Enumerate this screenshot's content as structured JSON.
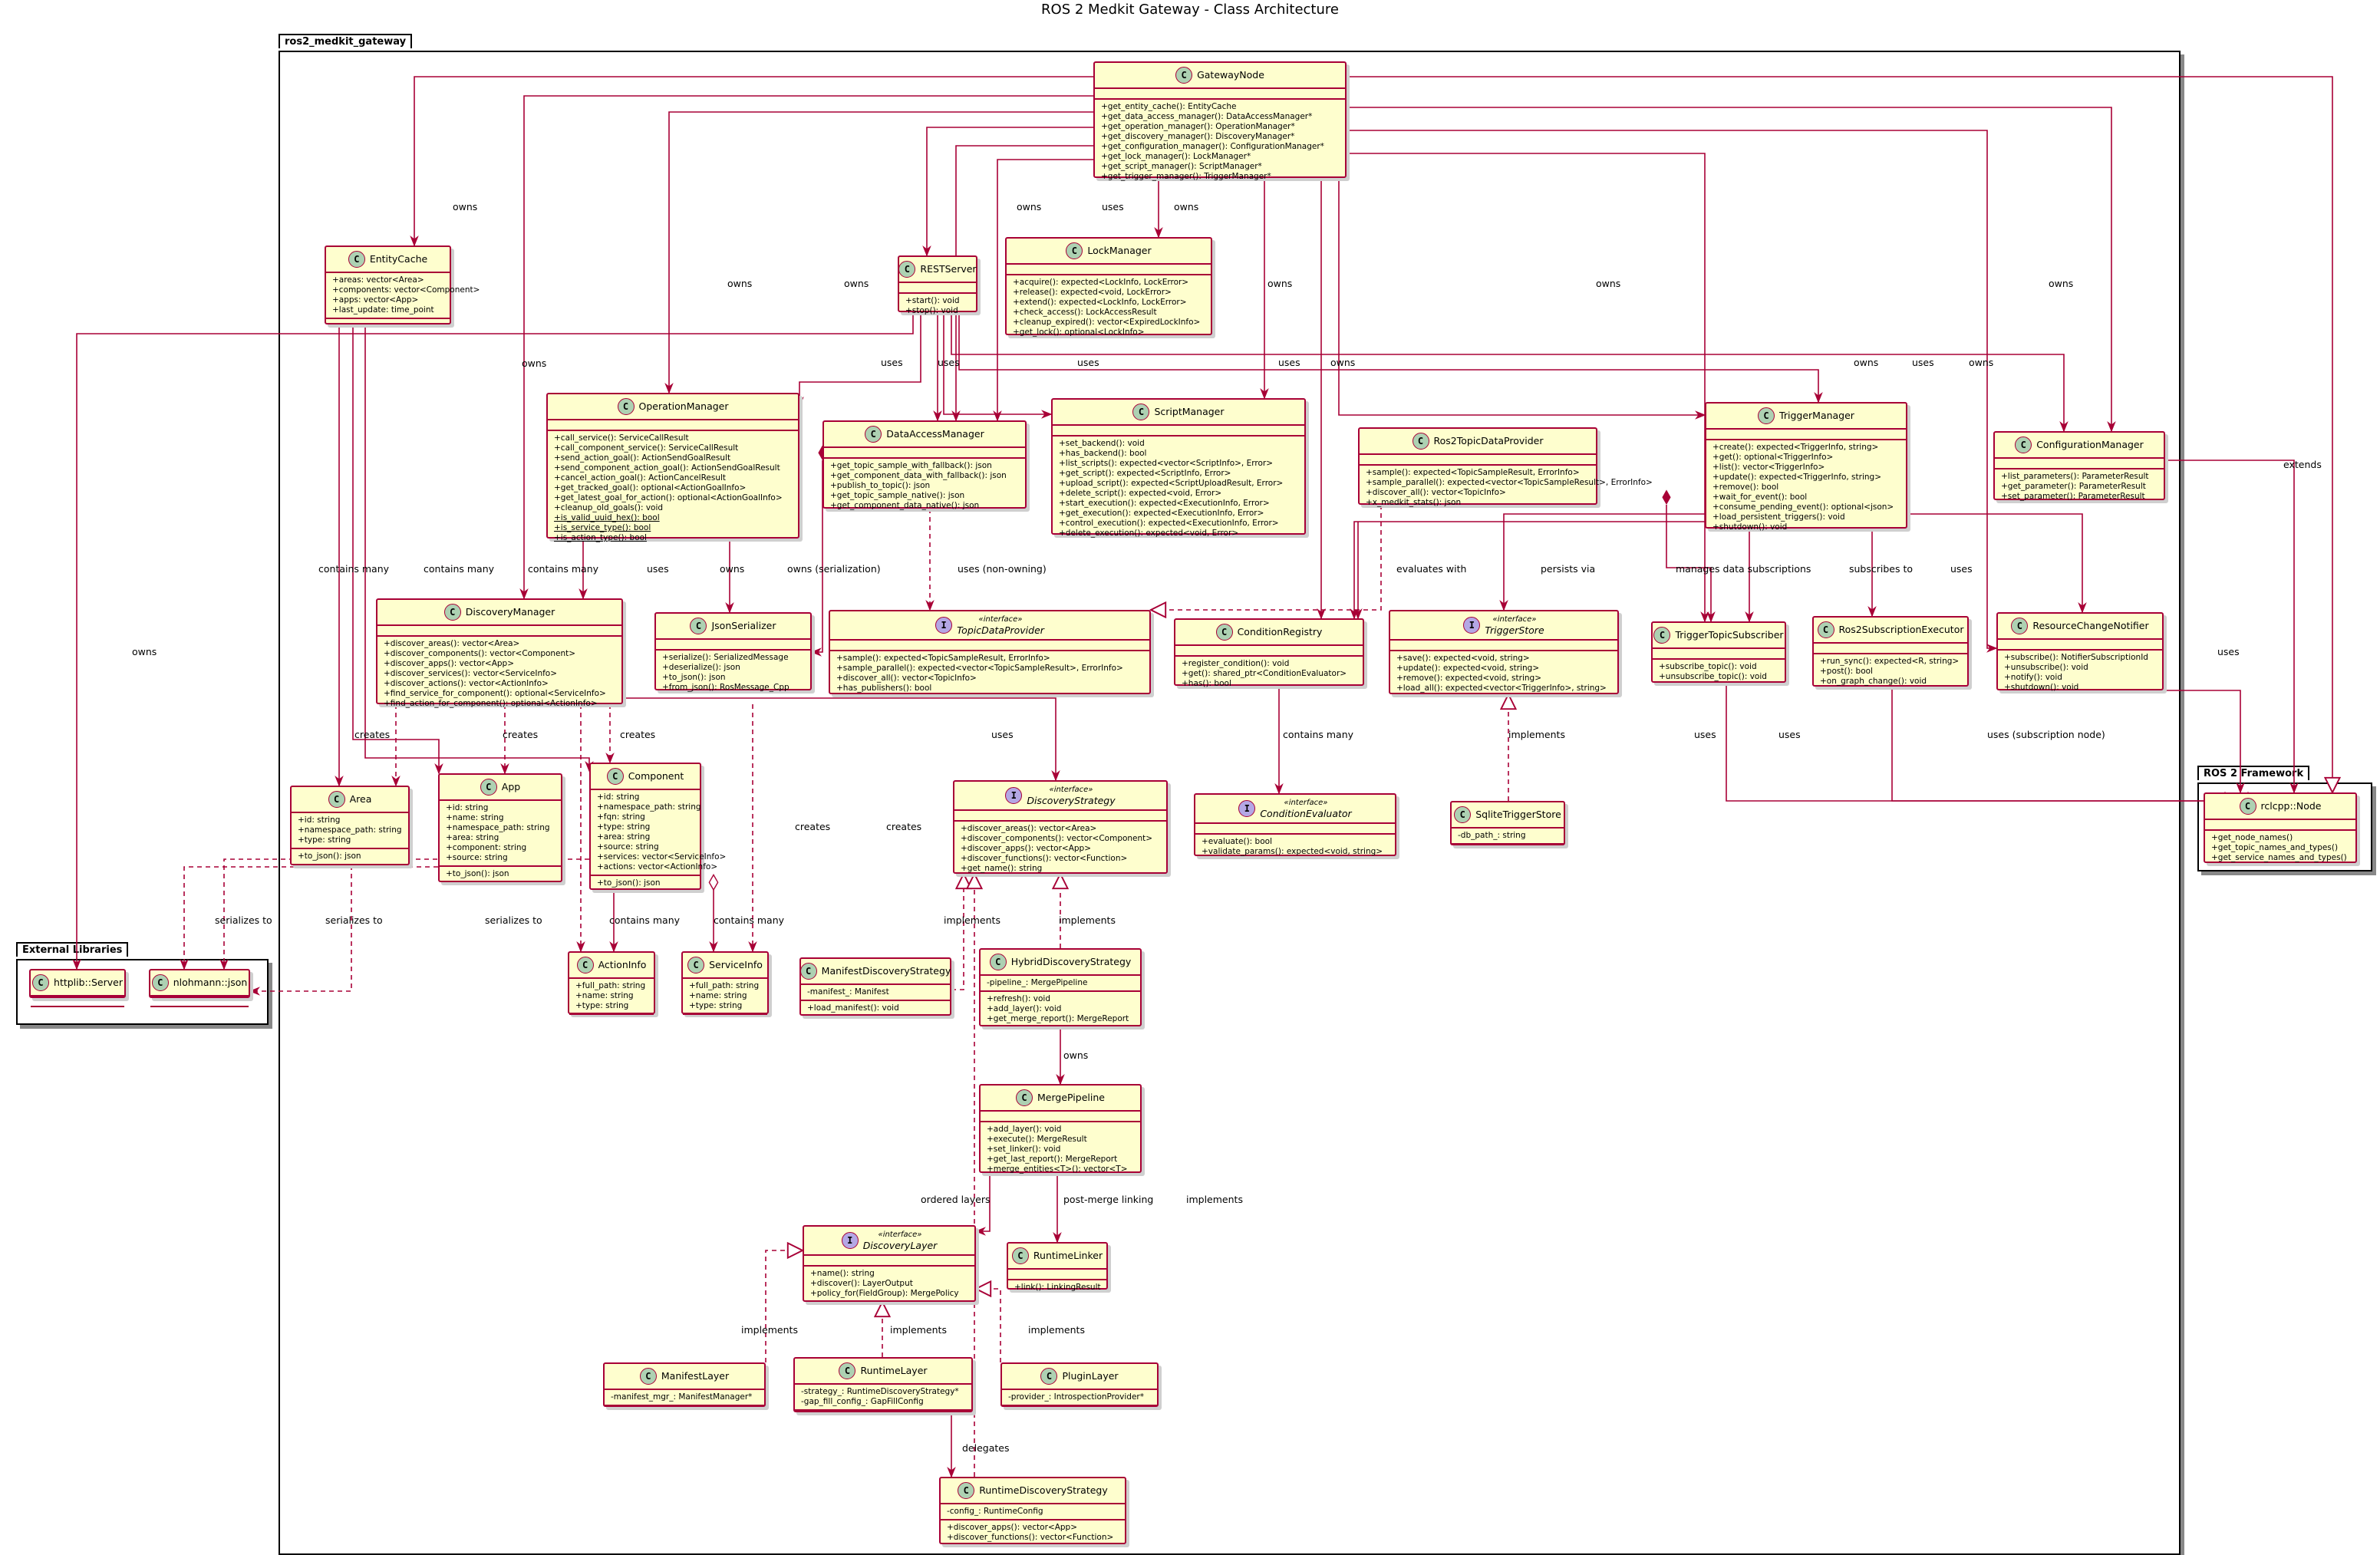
{
  "title": "ROS 2 Medkit Gateway - Class Architecture",
  "colors": {
    "border": "#A80036",
    "fill": "#FEFECE",
    "class_circle": "#ADD1B2",
    "interface_circle": "#B4A7E5"
  },
  "packages": {
    "gateway": {
      "name": "ros2_medkit_gateway"
    },
    "external": {
      "name": "External Libraries"
    },
    "ros2": {
      "name": "ROS 2 Framework"
    }
  },
  "classes": {
    "GatewayNode": {
      "name": "GatewayNode",
      "stereotype": "",
      "kind": "C",
      "attrs": [],
      "methods": [
        "+get_entity_cache(): EntityCache",
        "+get_data_access_manager(): DataAccessManager*",
        "+get_operation_manager(): OperationManager*",
        "+get_discovery_manager(): DiscoveryManager*",
        "+get_configuration_manager(): ConfigurationManager*",
        "+get_lock_manager(): LockManager*",
        "+get_script_manager(): ScriptManager*",
        "+get_trigger_manager(): TriggerManager*"
      ]
    },
    "EntityCache": {
      "name": "EntityCache",
      "kind": "C",
      "stereotype": "",
      "attrs": [
        "+areas: vector<Area>",
        "+components: vector<Component>",
        "+apps: vector<App>",
        "+last_update: time_point"
      ],
      "methods": []
    },
    "RESTServer": {
      "name": "RESTServer",
      "kind": "C",
      "stereotype": "",
      "attrs": [],
      "methods": [
        "+start(): void",
        "+stop(): void"
      ]
    },
    "LockManager": {
      "name": "LockManager",
      "kind": "C",
      "stereotype": "",
      "attrs": [],
      "methods": [
        "+acquire(): expected<LockInfo, LockError>",
        "+release(): expected<void, LockError>",
        "+extend(): expected<LockInfo, LockError>",
        "+check_access(): LockAccessResult",
        "+cleanup_expired(): vector<ExpiredLockInfo>",
        "+get_lock(): optional<LockInfo>"
      ]
    },
    "OperationManager": {
      "name": "OperationManager",
      "kind": "C",
      "stereotype": "",
      "attrs": [],
      "methods": [
        "+call_service(): ServiceCallResult",
        "+call_component_service(): ServiceCallResult",
        "+send_action_goal(): ActionSendGoalResult",
        "+send_component_action_goal(): ActionSendGoalResult",
        "+cancel_action_goal(): ActionCancelResult",
        "+get_tracked_goal(): optional<ActionGoalInfo>",
        "+get_latest_goal_for_action(): optional<ActionGoalInfo>",
        "+cleanup_old_goals(): void"
      ],
      "static_methods": [
        "+is_valid_uuid_hex(): bool",
        "+is_service_type(): bool",
        "+is_action_type(): bool"
      ]
    },
    "DataAccessManager": {
      "name": "DataAccessManager",
      "kind": "C",
      "stereotype": "",
      "attrs": [],
      "methods": [
        "+get_topic_sample_with_fallback(): json",
        "+get_component_data_with_fallback(): json",
        "+publish_to_topic(): json",
        "+get_topic_sample_native(): json",
        "+get_component_data_native(): json"
      ]
    },
    "ScriptManager": {
      "name": "ScriptManager",
      "kind": "C",
      "stereotype": "",
      "attrs": [],
      "methods": [
        "+set_backend(): void",
        "+has_backend(): bool",
        "+list_scripts(): expected<vector<ScriptInfo>, Error>",
        "+get_script(): expected<ScriptInfo, Error>",
        "+upload_script(): expected<ScriptUploadResult, Error>",
        "+delete_script(): expected<void, Error>",
        "+start_execution(): expected<ExecutionInfo, Error>",
        "+get_execution(): expected<ExecutionInfo, Error>",
        "+control_execution(): expected<ExecutionInfo, Error>",
        "+delete_execution(): expected<void, Error>"
      ]
    },
    "Ros2TopicDataProvider": {
      "name": "Ros2TopicDataProvider",
      "kind": "C",
      "stereotype": "",
      "attrs": [],
      "methods": [
        "+sample(): expected<TopicSampleResult, ErrorInfo>",
        "+sample_parallel(): expected<vector<TopicSampleResult>, ErrorInfo>",
        "+discover_all(): vector<TopicInfo>",
        "+x_medkit_stats(): json"
      ]
    },
    "TriggerManager": {
      "name": "TriggerManager",
      "kind": "C",
      "stereotype": "",
      "attrs": [],
      "methods": [
        "+create(): expected<TriggerInfo, string>",
        "+get(): optional<TriggerInfo>",
        "+list(): vector<TriggerInfo>",
        "+update(): expected<TriggerInfo, string>",
        "+remove(): bool",
        "+wait_for_event(): bool",
        "+consume_pending_event(): optional<json>",
        "+load_persistent_triggers(): void",
        "+shutdown(): void"
      ]
    },
    "ConfigurationManager": {
      "name": "ConfigurationManager",
      "kind": "C",
      "stereotype": "",
      "attrs": [],
      "methods": [
        "+list_parameters(): ParameterResult",
        "+get_parameter(): ParameterResult",
        "+set_parameter(): ParameterResult"
      ]
    },
    "DiscoveryManager": {
      "name": "DiscoveryManager",
      "kind": "C",
      "stereotype": "",
      "attrs": [],
      "methods": [
        "+discover_areas(): vector<Area>",
        "+discover_components(): vector<Component>",
        "+discover_apps(): vector<App>",
        "+discover_services(): vector<ServiceInfo>",
        "+discover_actions(): vector<ActionInfo>",
        "+find_service_for_component(): optional<ServiceInfo>",
        "+find_action_for_component(): optional<ActionInfo>"
      ]
    },
    "JsonSerializer": {
      "name": "JsonSerializer",
      "kind": "C",
      "stereotype": "",
      "attrs": [],
      "methods": [
        "+serialize(): SerializedMessage",
        "+deserialize(): json",
        "+to_json(): json",
        "+from_json(): RosMessage_Cpp"
      ]
    },
    "TopicDataProvider": {
      "name": "TopicDataProvider",
      "kind": "I",
      "stereotype": "«interface»",
      "attrs": [],
      "methods": [
        "+sample(): expected<TopicSampleResult, ErrorInfo>",
        "+sample_parallel(): expected<vector<TopicSampleResult>, ErrorInfo>",
        "+discover_all(): vector<TopicInfo>",
        "+has_publishers(): bool"
      ]
    },
    "ConditionRegistry": {
      "name": "ConditionRegistry",
      "kind": "C",
      "stereotype": "",
      "attrs": [],
      "methods": [
        "+register_condition(): void",
        "+get(): shared_ptr<ConditionEvaluator>",
        "+has(): bool"
      ]
    },
    "TriggerStore": {
      "name": "TriggerStore",
      "kind": "I",
      "stereotype": "«interface»",
      "attrs": [],
      "methods": [
        "+save(): expected<void, string>",
        "+update(): expected<void, string>",
        "+remove(): expected<void, string>",
        "+load_all(): expected<vector<TriggerInfo>, string>"
      ]
    },
    "TriggerTopicSubscriber": {
      "name": "TriggerTopicSubscriber",
      "kind": "C",
      "stereotype": "",
      "attrs": [],
      "methods": [
        "+subscribe_topic(): void",
        "+unsubscribe_topic(): void"
      ]
    },
    "Ros2SubscriptionExecutor": {
      "name": "Ros2SubscriptionExecutor",
      "kind": "C",
      "stereotype": "",
      "attrs": [],
      "methods": [
        "+run_sync(): expected<R, string>",
        "+post(): bool",
        "+on_graph_change(): void"
      ]
    },
    "ResourceChangeNotifier": {
      "name": "ResourceChangeNotifier",
      "kind": "C",
      "stereotype": "",
      "attrs": [],
      "methods": [
        "+subscribe(): NotifierSubscriptionId",
        "+unsubscribe(): void",
        "+notify(): void",
        "+shutdown(): void"
      ]
    },
    "Area": {
      "name": "Area",
      "kind": "C",
      "stereotype": "",
      "attrs": [
        "+id: string",
        "+namespace_path: string",
        "+type: string"
      ],
      "methods": [
        "+to_json(): json"
      ]
    },
    "App": {
      "name": "App",
      "kind": "C",
      "stereotype": "",
      "attrs": [
        "+id: string",
        "+name: string",
        "+namespace_path: string",
        "+area: string",
        "+component: string",
        "+source: string"
      ],
      "methods": [
        "+to_json(): json"
      ]
    },
    "Component": {
      "name": "Component",
      "kind": "C",
      "stereotype": "",
      "attrs": [
        "+id: string",
        "+namespace_path: string",
        "+fqn: string",
        "+type: string",
        "+area: string",
        "+source: string",
        "+services: vector<ServiceInfo>",
        "+actions: vector<ActionInfo>"
      ],
      "methods": [
        "+to_json(): json"
      ]
    },
    "DiscoveryStrategy": {
      "name": "DiscoveryStrategy",
      "kind": "I",
      "stereotype": "«interface»",
      "attrs": [],
      "methods": [
        "+discover_areas(): vector<Area>",
        "+discover_components(): vector<Component>",
        "+discover_apps(): vector<App>",
        "+discover_functions(): vector<Function>",
        "+get_name(): string"
      ]
    },
    "ConditionEvaluator": {
      "name": "ConditionEvaluator",
      "kind": "I",
      "stereotype": "«interface»",
      "attrs": [],
      "methods": [
        "+evaluate(): bool",
        "+validate_params(): expected<void, string>"
      ]
    },
    "SqliteTriggerStore": {
      "name": "SqliteTriggerStore",
      "kind": "C",
      "stereotype": "",
      "attrs": [
        "-db_path_: string"
      ],
      "methods": []
    },
    "ActionInfo": {
      "name": "ActionInfo",
      "kind": "C",
      "stereotype": "",
      "attrs": [
        "+full_path: string",
        "+name: string",
        "+type: string"
      ],
      "methods": []
    },
    "ServiceInfo": {
      "name": "ServiceInfo",
      "kind": "C",
      "stereotype": "",
      "attrs": [
        "+full_path: string",
        "+name: string",
        "+type: string"
      ],
      "methods": []
    },
    "ManifestDiscoveryStrategy": {
      "name": "ManifestDiscoveryStrategy",
      "kind": "C",
      "stereotype": "",
      "attrs": [
        "-manifest_: Manifest"
      ],
      "methods": [
        "+load_manifest(): void"
      ]
    },
    "HybridDiscoveryStrategy": {
      "name": "HybridDiscoveryStrategy",
      "kind": "C",
      "stereotype": "",
      "attrs": [
        "-pipeline_: MergePipeline"
      ],
      "methods": [
        "+refresh(): void",
        "+add_layer(): void",
        "+get_merge_report(): MergeReport"
      ]
    },
    "MergePipeline": {
      "name": "MergePipeline",
      "kind": "C",
      "stereotype": "",
      "attrs": [],
      "methods": [
        "+add_layer(): void",
        "+execute(): MergeResult",
        "+set_linker(): void",
        "+get_last_report(): MergeReport",
        "+merge_entities<T>(): vector<T>"
      ]
    },
    "RuntimeLinker": {
      "name": "RuntimeLinker",
      "kind": "C",
      "stereotype": "",
      "attrs": [],
      "methods": [
        "+link(): LinkingResult"
      ]
    },
    "DiscoveryLayer": {
      "name": "DiscoveryLayer",
      "kind": "I",
      "stereotype": "«interface»",
      "attrs": [],
      "methods": [
        "+name(): string",
        "+discover(): LayerOutput",
        "+policy_for(FieldGroup): MergePolicy"
      ]
    },
    "ManifestLayer": {
      "name": "ManifestLayer",
      "kind": "C",
      "stereotype": "",
      "attrs": [
        "-manifest_mgr_: ManifestManager*"
      ],
      "methods": []
    },
    "RuntimeLayer": {
      "name": "RuntimeLayer",
      "kind": "C",
      "stereotype": "",
      "attrs": [
        "-strategy_: RuntimeDiscoveryStrategy*",
        "-gap_fill_config_: GapFillConfig"
      ],
      "methods": []
    },
    "PluginLayer": {
      "name": "PluginLayer",
      "kind": "C",
      "stereotype": "",
      "attrs": [
        "-provider_: IntrospectionProvider*"
      ],
      "methods": []
    },
    "RuntimeDiscoveryStrategy": {
      "name": "RuntimeDiscoveryStrategy",
      "kind": "C",
      "stereotype": "",
      "attrs": [
        "-config_: RuntimeConfig"
      ],
      "methods": [
        "+discover_apps(): vector<App>",
        "+discover_functions(): vector<Function>"
      ]
    },
    "HttplibServer": {
      "name": "httplib::Server",
      "kind": "C",
      "stereotype": "",
      "attrs": [],
      "methods": []
    },
    "NlohmannJson": {
      "name": "nlohmann::json",
      "kind": "C",
      "stereotype": "",
      "attrs": [],
      "methods": []
    },
    "RclcppNode": {
      "name": "rclcpp::Node",
      "kind": "C",
      "stereotype": "",
      "attrs": [],
      "methods": [
        "+get_node_names()",
        "+get_topic_names_and_types()",
        "+get_service_names_and_types()"
      ]
    }
  },
  "labels": {
    "gw_cache_owns": "owns",
    "gw_rest_owns": "owns",
    "gw_op_owns": "owns",
    "gw_disc_owns": "owns",
    "gw_lock_uses": "uses",
    "gw_lock_owns": "owns",
    "gw_script_owns": "owns",
    "gw_trig_owns": "owns",
    "gw_config_owns": "owns",
    "gw_ext_uses": "uses",
    "rest_http_owns": "owns",
    "rest_op_uses": "uses",
    "rest_data_uses": "uses",
    "rest_script_uses": "uses",
    "rest_trig_uses": "uses",
    "rest_config_uses": "uses",
    "cache_area_many": "contains many",
    "cache_comp_many": "contains many",
    "disc_cache_many": "contains many",
    "op_json_uses": "uses",
    "op_json_owns": "owns",
    "data_ser_owns": "owns (serialization)",
    "data_prov_uses": "uses (non-owning)",
    "trig_cond_eval": "evaluates with",
    "trig_store_persist": "persists via",
    "trig_sub_manage": "manages data subscriptions",
    "trig_exec_sub": "subscribes to",
    "trig_notif_uses": "uses",
    "config_extends": "extends",
    "disc_area_creates": "creates",
    "disc_app_creates": "creates",
    "disc_comp_creates": "creates",
    "disc_action_creates": "creates",
    "disc_service_creates": "creates",
    "disc_strategy_uses": "uses",
    "cond_eval_many": "contains many",
    "sqlite_implements": "implements",
    "sub_node_uses": "uses",
    "exec_node_uses": "uses",
    "notif_node_uses": "uses (subscription node)",
    "area_json_ser": "serializes to",
    "app_json_ser": "serializes to",
    "comp_json_ser": "serializes to",
    "comp_action_many": "contains many",
    "comp_service_many": "contains many",
    "manifest_implements": "implements",
    "hybrid_implements": "implements",
    "hybrid_owns": "owns",
    "merge_layers": "ordered layers",
    "merge_link": "post-merge linking",
    "runtime_strategy_implements": "implements",
    "manifest_layer_impl": "implements",
    "runtime_layer_impl": "implements",
    "plugin_layer_impl": "implements",
    "runtime_delegates": "delegates"
  }
}
